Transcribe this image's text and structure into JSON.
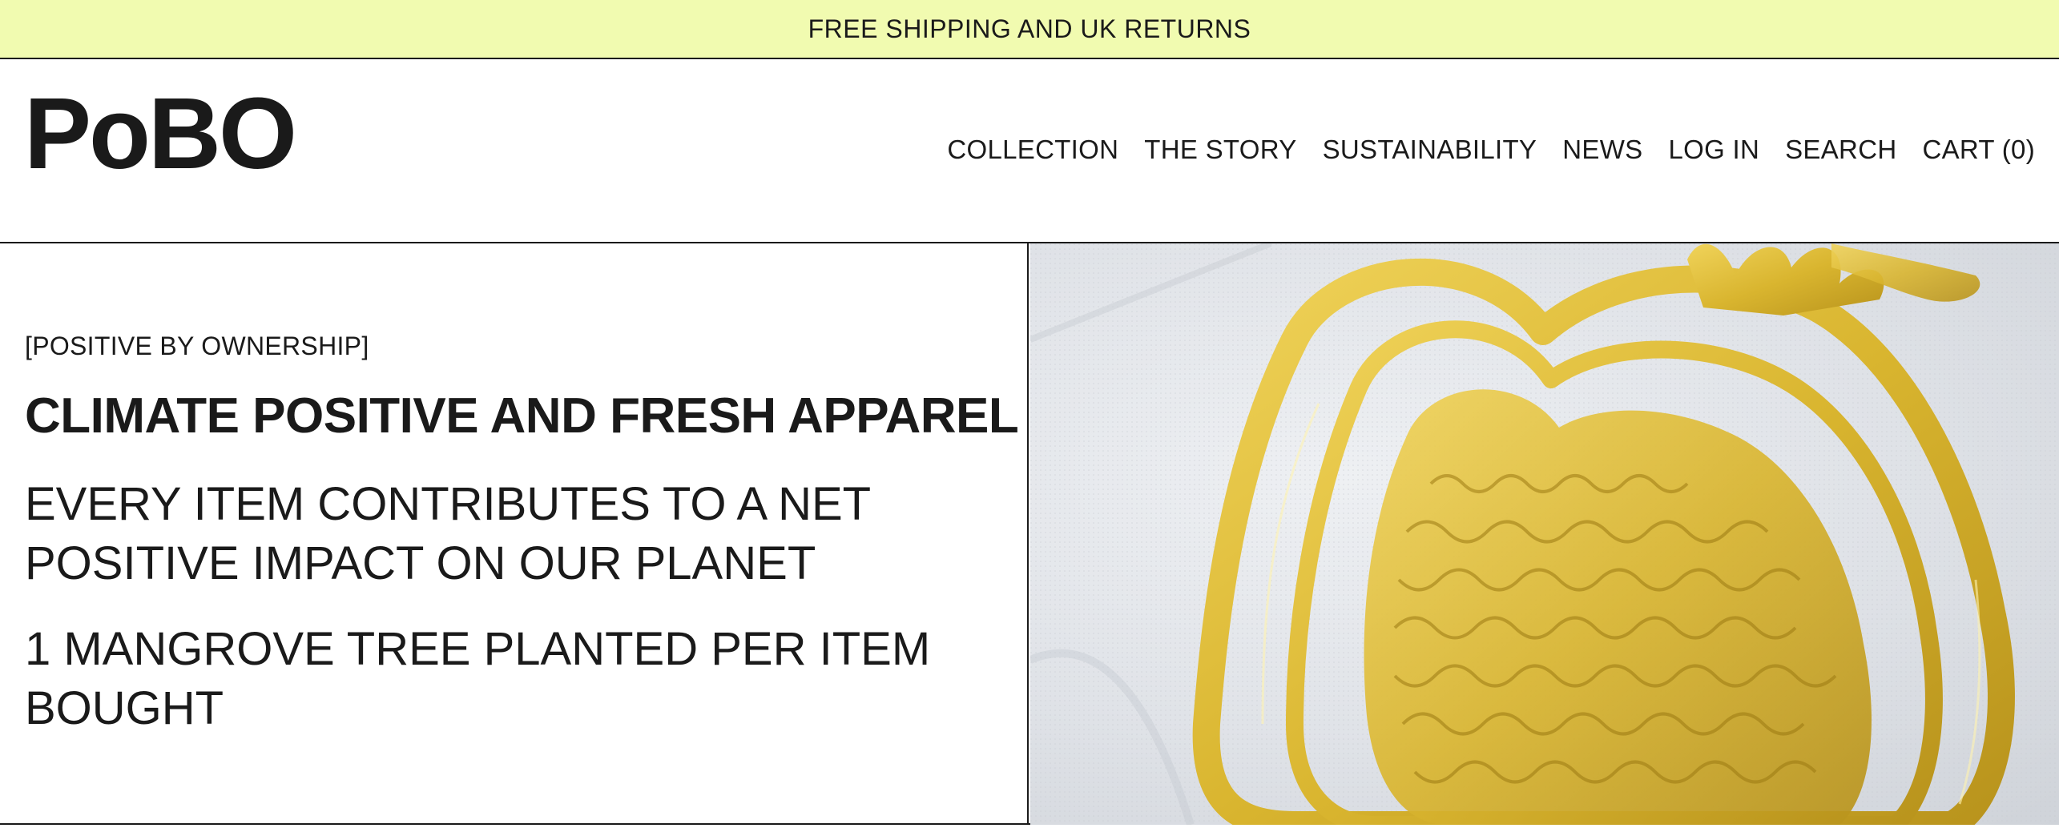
{
  "announcement": {
    "text": "FREE SHIPPING AND UK RETURNS"
  },
  "header": {
    "logo": "PoBO",
    "nav": [
      {
        "label": "COLLECTION"
      },
      {
        "label": "THE STORY"
      },
      {
        "label": "SUSTAINABILITY"
      },
      {
        "label": "NEWS"
      },
      {
        "label": "LOG IN"
      },
      {
        "label": "SEARCH"
      },
      {
        "label": "CART (0)"
      }
    ]
  },
  "hero": {
    "eyebrow": "[POSITIVE BY OWNERSHIP]",
    "headline": "CLIMATE POSITIVE AND FRESH APPAREL",
    "line1": "EVERY ITEM CONTRIBUTES TO A NET POSITIVE IMPACT ON OUR PLANET",
    "line2": "1 MANGROVE TREE PLANTED PER ITEM BOUGHT"
  },
  "colors": {
    "announcement_bg": "#f1fbb0",
    "text": "#1a1a1a",
    "embroidery_gold": "#d9b52f"
  }
}
